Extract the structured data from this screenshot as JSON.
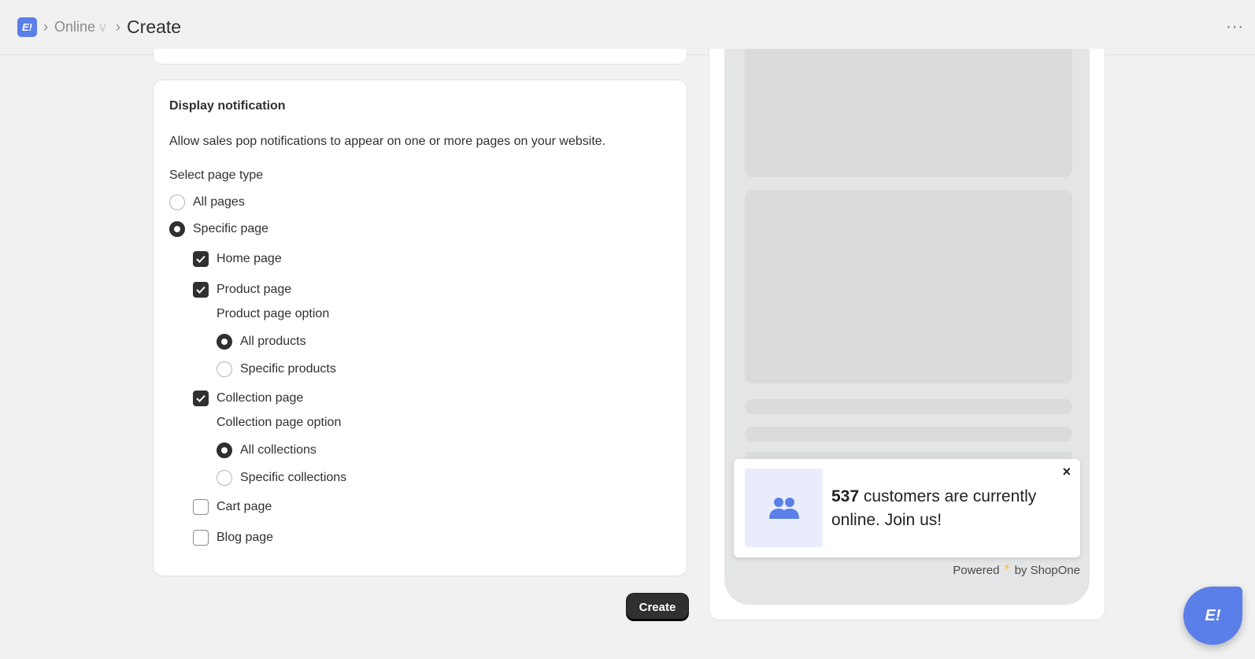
{
  "header": {
    "app_logo": "E!",
    "breadcrumb_link": "Online",
    "breadcrumb_link_fade": "v",
    "current_page": "Create",
    "more_icon": "···"
  },
  "display_notification": {
    "title": "Display notification",
    "description": "Allow sales pop notifications to appear on one or more pages on your website.",
    "select_page_type_label": "Select page type",
    "page_type_options": [
      {
        "label": "All pages",
        "selected": false
      },
      {
        "label": "Specific page",
        "selected": true
      }
    ],
    "pages": {
      "home": {
        "label": "Home page",
        "checked": true
      },
      "product": {
        "label": "Product page",
        "checked": true,
        "option_label": "Product page option",
        "options": [
          {
            "label": "All products",
            "selected": true
          },
          {
            "label": "Specific products",
            "selected": false
          }
        ]
      },
      "collection": {
        "label": "Collection page",
        "checked": true,
        "option_label": "Collection page option",
        "options": [
          {
            "label": "All collections",
            "selected": true
          },
          {
            "label": "Specific collections",
            "selected": false
          }
        ]
      },
      "cart": {
        "label": "Cart page",
        "checked": false
      },
      "blog": {
        "label": "Blog page",
        "checked": false
      }
    }
  },
  "actions": {
    "create_label": "Create"
  },
  "preview": {
    "popup": {
      "count": "537",
      "message": " customers are currently online. Join us!",
      "close": "×",
      "image_icon": "users-icon"
    },
    "powered_prefix": "Powered",
    "powered_suffix": "by ShopOne"
  },
  "fab": {
    "label": "E!"
  },
  "colors": {
    "accent": "#5b7fe8",
    "dark": "#303030",
    "background": "#f1f1f1"
  }
}
